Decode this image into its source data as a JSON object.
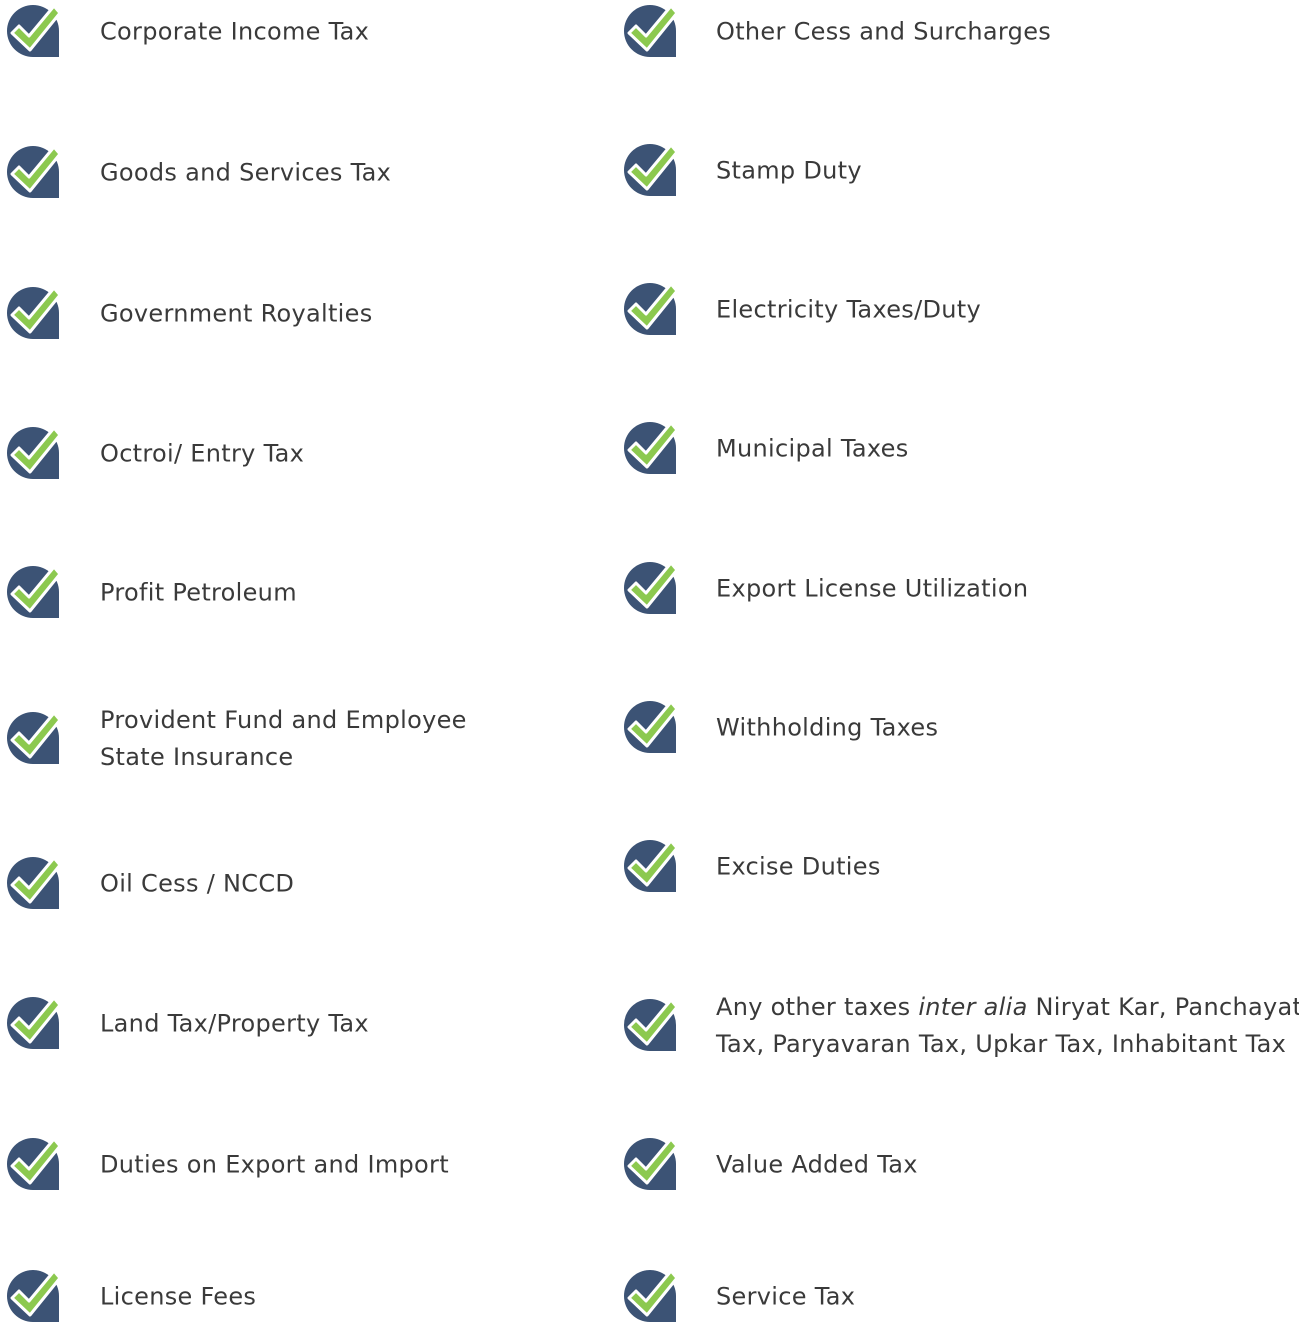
{
  "colors": {
    "badge": "#3c5375",
    "check": "#8cc94f",
    "text": "#3a3a3a",
    "background": "#ffffff"
  },
  "icon": "check-badge-icon",
  "left_column": [
    {
      "lines": [
        "Corporate Income Tax"
      ]
    },
    {
      "lines": [
        "Goods and Services Tax"
      ]
    },
    {
      "lines": [
        "Government Royalties"
      ]
    },
    {
      "lines": [
        "Octroi/ Entry Tax"
      ]
    },
    {
      "lines": [
        "Profit Petroleum"
      ]
    },
    {
      "lines": [
        "Provident Fund and Employee",
        "State Insurance"
      ]
    },
    {
      "lines": [
        "Oil Cess / NCCD"
      ]
    },
    {
      "lines": [
        "Land Tax/Property Tax"
      ]
    },
    {
      "lines": [
        "Duties on Export and Import"
      ]
    },
    {
      "lines": [
        "License Fees"
      ]
    }
  ],
  "right_column": [
    {
      "lines": [
        "Other Cess and Surcharges"
      ]
    },
    {
      "lines": [
        "Stamp Duty"
      ]
    },
    {
      "lines": [
        "Electricity Taxes/Duty"
      ]
    },
    {
      "lines": [
        "Municipal Taxes"
      ]
    },
    {
      "lines": [
        "Export License Utilization"
      ]
    },
    {
      "lines": [
        "Withholding Taxes"
      ]
    },
    {
      "lines": [
        "Excise Duties"
      ]
    },
    {
      "lines": [
        "Any other taxes inter alia Niryat Kar, Panchayat",
        "Tax, Paryavaran Tax, Upkar Tax, Inhabitant Tax"
      ],
      "line1_before": "Any other taxes ",
      "line1_italic": "inter alia",
      "line1_after": " Niryat Kar, Panchayat",
      "line2": "Tax, Paryavaran Tax, Upkar Tax, Inhabitant Tax"
    },
    {
      "lines": [
        "Value Added Tax"
      ]
    },
    {
      "lines": [
        "Service Tax"
      ]
    }
  ]
}
